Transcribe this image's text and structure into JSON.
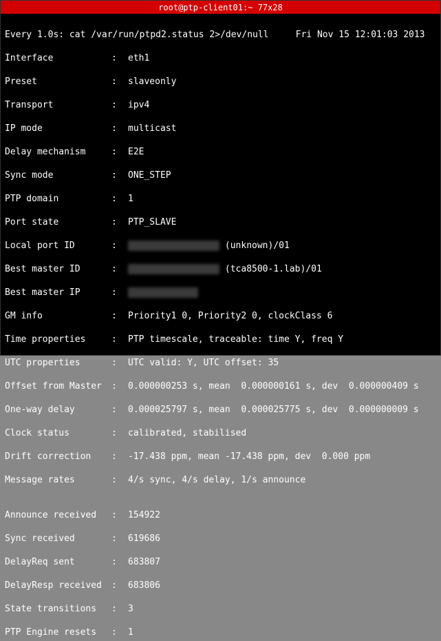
{
  "titlebar": "root@ptp-client01:~ 77x28",
  "header": {
    "left": "Every 1.0s: cat /var/run/ptpd2.status 2>/dev/null",
    "right": "Fri Nov 15 12:01:03 2013"
  },
  "fields": [
    {
      "label": "Interface",
      "value": "eth1"
    },
    {
      "label": "Preset",
      "value": "slaveonly"
    },
    {
      "label": "Transport",
      "value": "ipv4"
    },
    {
      "label": "IP mode",
      "value": "multicast"
    },
    {
      "label": "Delay mechanism",
      "value": "E2E"
    },
    {
      "label": "Sync mode",
      "value": "ONE_STEP"
    },
    {
      "label": "PTP domain",
      "value": "1"
    },
    {
      "label": "Port state",
      "value": "PTP_SLAVE"
    }
  ],
  "localPortId": {
    "label": "Local port ID",
    "redacted": "xxxxxxxxxxxxxxxxx",
    "suffix": "(unknown)/01"
  },
  "bestMasterId": {
    "label": "Best master ID",
    "redacted": "xxxxxxxxxxxxxxxxx",
    "suffix": "(tca8500-1.lab)/01"
  },
  "bestMasterIp": {
    "label": "Best master IP",
    "redacted": "xxx.xx.xxx.xx"
  },
  "fields2": [
    {
      "label": "GM info",
      "value": "Priority1 0, Priority2 0, clockClass 6"
    },
    {
      "label": "Time properties",
      "value": "PTP timescale, traceable: time Y, freq Y"
    },
    {
      "label": "UTC properties",
      "value": "UTC valid: Y, UTC offset: 35"
    },
    {
      "label": "Offset from Master",
      "value": "0.000000253 s, mean  0.000000161 s, dev  0.000000409 s"
    },
    {
      "label": "One-way delay",
      "value": "0.000025797 s, mean  0.000025775 s, dev  0.000000009 s"
    },
    {
      "label": "Clock status",
      "value": "calibrated, stabilised"
    },
    {
      "label": "Drift correction",
      "value": "-17.438 ppm, mean -17.438 ppm, dev  0.000 ppm"
    },
    {
      "label": "Message rates",
      "value": "4/s sync, 4/s delay, 1/s announce"
    }
  ],
  "fields3": [
    {
      "label": "Announce received",
      "value": "154922"
    },
    {
      "label": "Sync received",
      "value": "619686"
    },
    {
      "label": "DelayReq sent",
      "value": "683807"
    },
    {
      "label": "DelayResp received",
      "value": "683806"
    },
    {
      "label": "State transitions",
      "value": "3"
    },
    {
      "label": "PTP Engine resets",
      "value": "1"
    }
  ]
}
